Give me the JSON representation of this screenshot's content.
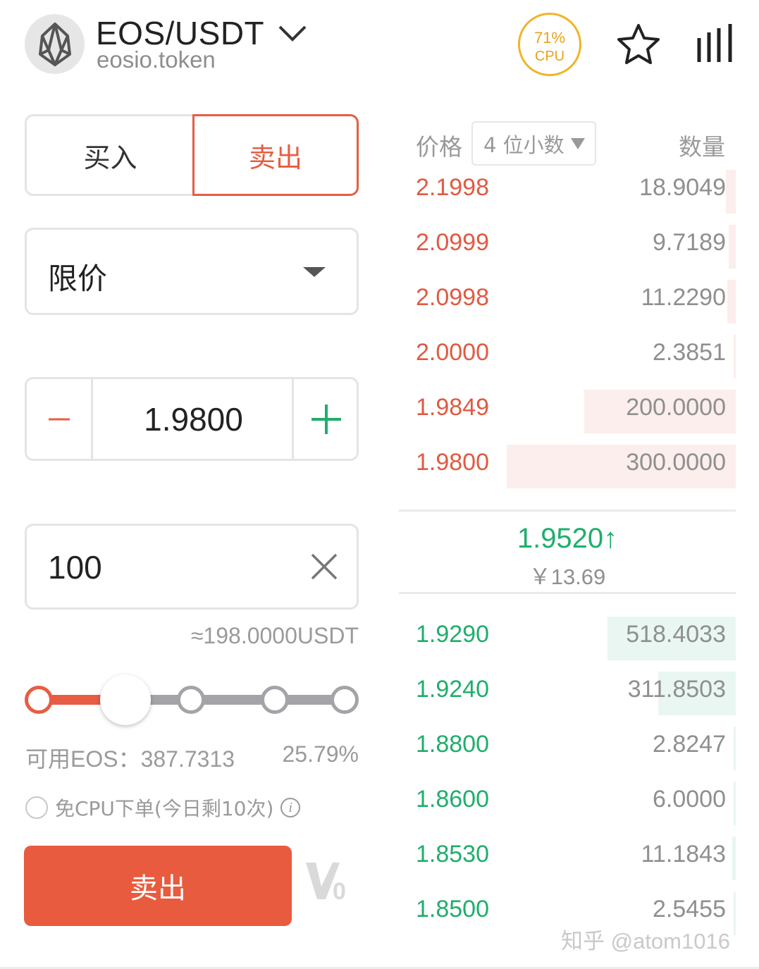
{
  "header": {
    "pair": "EOS/USDT",
    "contract": "eosio.token",
    "cpu_percent": "71%",
    "cpu_label": "CPU",
    "colors": {
      "cpu_ring": "#f0b429"
    }
  },
  "trade": {
    "buy_tab": "买入",
    "sell_tab": "卖出",
    "order_type": "限价",
    "price": "1.9800",
    "amount": "100",
    "approx_value": "≈198.0000USDT",
    "slider_percent": 25.79,
    "available": "可用EOS：387.7313",
    "available_percent": "25.79%",
    "free_cpu": "免CPU下单(今日剩10次)",
    "submit": "卖出",
    "colors": {
      "sell": "#e95b3e",
      "buy": "#1fae6c"
    }
  },
  "orderbook": {
    "price_header": "价格",
    "decimal_select": "4 位小数",
    "qty_header": "数量",
    "asks": [
      {
        "price": "2.1998",
        "qty": "18.9049",
        "depth": 0.03
      },
      {
        "price": "2.0999",
        "qty": "9.7189",
        "depth": 0.02
      },
      {
        "price": "2.0998",
        "qty": "11.2290",
        "depth": 0.025
      },
      {
        "price": "2.0000",
        "qty": "2.3851",
        "depth": 0.006
      },
      {
        "price": "1.9849",
        "qty": "200.0000",
        "depth": 0.45
      },
      {
        "price": "1.9800",
        "qty": "300.0000",
        "depth": 0.68
      }
    ],
    "last_price": "1.9520↑",
    "last_cny": "￥13.69",
    "bids": [
      {
        "price": "1.9290",
        "qty": "518.4033",
        "depth": 0.38
      },
      {
        "price": "1.9240",
        "qty": "311.8503",
        "depth": 0.23
      },
      {
        "price": "1.8800",
        "qty": "2.8247",
        "depth": 0.005
      },
      {
        "price": "1.8600",
        "qty": "6.0000",
        "depth": 0.006
      },
      {
        "price": "1.8530",
        "qty": "11.1843",
        "depth": 0.01
      },
      {
        "price": "1.8500",
        "qty": "2.5455",
        "depth": 0.005
      }
    ]
  },
  "watermark": "知乎 @atom1016"
}
